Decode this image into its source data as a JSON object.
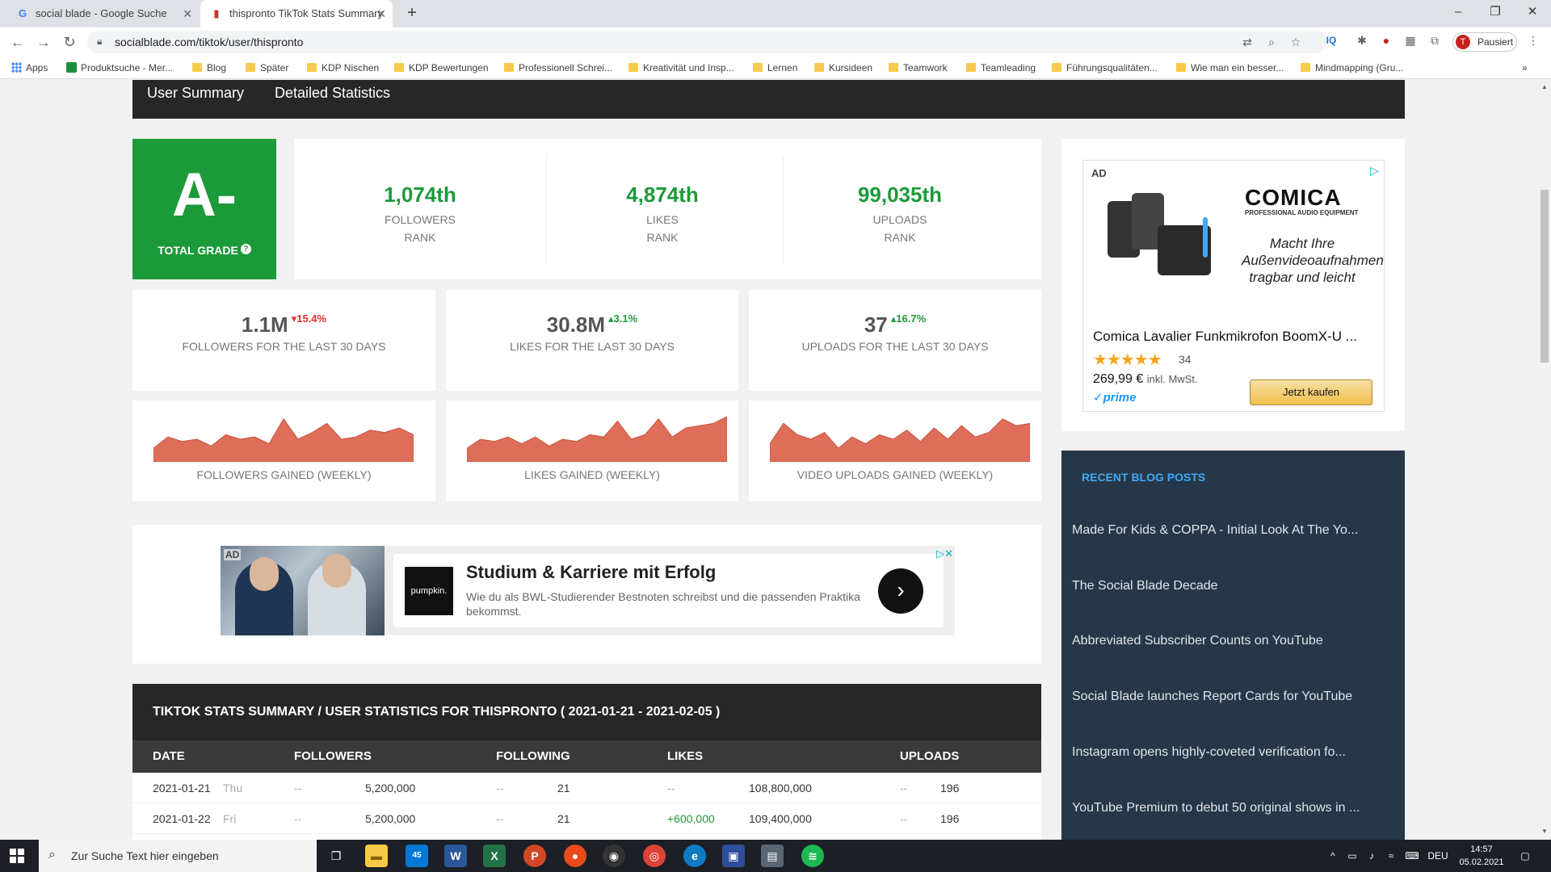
{
  "browser": {
    "tabs": [
      {
        "title": "social blade - Google Suche",
        "favicon": "G"
      },
      {
        "title": "thispronto TikTok Stats Summary",
        "favicon": "▮"
      }
    ],
    "url": "socialblade.com/tiktok/user/thispronto",
    "profile_label": "Pausiert",
    "profile_initial": "T",
    "bookmarks": [
      "Apps",
      "Produktsuche - Mer...",
      "Blog",
      "Später",
      "KDP Nischen",
      "KDP Bewertungen",
      "Professionell Schrei...",
      "Kreativität und Insp...",
      "Lernen",
      "Kursideen",
      "Teamwork",
      "Teamleading",
      "Führungsqualitäten...",
      "Wie man ein besser...",
      "Mindmapping (Gru..."
    ]
  },
  "subnav": {
    "summary": "User Summary",
    "detailed": "Detailed Statistics"
  },
  "grade": {
    "letter": "A-",
    "label": "TOTAL GRADE",
    "help": "?"
  },
  "ranks": [
    {
      "value": "1,074th",
      "label1": "FOLLOWERS",
      "label2": "RANK"
    },
    {
      "value": "4,874th",
      "label1": "LIKES",
      "label2": "RANK"
    },
    {
      "value": "99,035th",
      "label1": "UPLOADS",
      "label2": "RANK"
    }
  ],
  "stats": [
    {
      "value": "1.1M",
      "change": "▾15.4%",
      "direction": "down",
      "label": "FOLLOWERS FOR THE LAST 30 DAYS"
    },
    {
      "value": "30.8M",
      "change": "▴3.1%",
      "direction": "up",
      "label": "LIKES FOR THE LAST 30 DAYS"
    },
    {
      "value": "37",
      "change": "▴16.7%",
      "direction": "up",
      "label": "UPLOADS FOR THE LAST 30 DAYS"
    }
  ],
  "graphs": [
    {
      "label": "FOLLOWERS GAINED (WEEKLY)",
      "values": [
        0.3,
        0.55,
        0.45,
        0.5,
        0.35,
        0.6,
        0.5,
        0.55,
        0.4,
        0.95,
        0.5,
        0.65,
        0.85,
        0.5,
        0.55,
        0.7,
        0.65,
        0.75,
        0.6
      ]
    },
    {
      "label": "LIKES GAINED (WEEKLY)",
      "values": [
        0.3,
        0.5,
        0.45,
        0.55,
        0.4,
        0.55,
        0.35,
        0.5,
        0.45,
        0.6,
        0.55,
        0.9,
        0.5,
        0.6,
        0.95,
        0.55,
        0.75,
        0.8,
        0.85,
        1.0
      ]
    },
    {
      "label": "VIDEO UPLOADS GAINED (WEEKLY)",
      "values": [
        0.4,
        0.85,
        0.6,
        0.5,
        0.65,
        0.3,
        0.55,
        0.4,
        0.6,
        0.5,
        0.7,
        0.45,
        0.75,
        0.5,
        0.8,
        0.55,
        0.65,
        0.95,
        0.8,
        0.85
      ]
    }
  ],
  "color_accent": "#1c9a3a",
  "banner_ad": {
    "tag": "AD",
    "logo": "pumpkin.",
    "headline": "Studium & Karriere mit Erfolg",
    "description": "Wie du als BWL-Studierender Bestnoten schreibst und die passenden Praktika bekommst.",
    "close": "▷✕"
  },
  "table": {
    "title": "TIKTOK STATS SUMMARY / USER STATISTICS FOR THISPRONTO ( 2021-01-21 - 2021-02-05 )",
    "headers": {
      "date": "DATE",
      "followers": "FOLLOWERS",
      "following": "FOLLOWING",
      "likes": "LIKES",
      "uploads": "UPLOADS"
    },
    "rows": [
      {
        "date": "2021-01-21",
        "day": "Thu",
        "followers_change": "--",
        "followers": "5,200,000",
        "following_change": "--",
        "following": "21",
        "likes_change": "--",
        "likes": "108,800,000",
        "uploads_change": "--",
        "uploads": "196"
      },
      {
        "date": "2021-01-22",
        "day": "Fri",
        "followers_change": "--",
        "followers": "5,200,000",
        "following_change": "--",
        "following": "21",
        "likes_change": "+600,000",
        "likes": "109,400,000",
        "uploads_change": "--",
        "uploads": "196"
      }
    ]
  },
  "sidebar_ad": {
    "tag": "AD",
    "brand": "COMICA",
    "brand_sub": "PROFESSIONAL AUDIO EQUIPMENT",
    "tagline": "Macht Ihre Außenvideoaufnahmen tragbar und leicht",
    "title": "Comica Lavalier Funkmikrofon BoomX-U ...",
    "stars": "★★★★★",
    "review_count": "34",
    "rating": 4.5,
    "price": "269,99 €",
    "vat": "inkl. MwSt.",
    "prime": "✓prime",
    "buy_label": "Jetzt kaufen"
  },
  "blog": {
    "title": "RECENT BLOG POSTS",
    "posts": [
      "Made For Kids & COPPA - Initial Look At The Yo...",
      "The Social Blade Decade",
      "Abbreviated Subscriber Counts on YouTube",
      "Social Blade launches Report Cards for YouTube",
      "Instagram opens highly-coveted verification fo...",
      "YouTube Premium to debut 50 original shows in ..."
    ]
  },
  "taskbar": {
    "search_placeholder": "Zur Suche Text hier eingeben",
    "language": "DEU",
    "time": "14:57",
    "date": "05.02.2021",
    "mail_badge": "45"
  }
}
